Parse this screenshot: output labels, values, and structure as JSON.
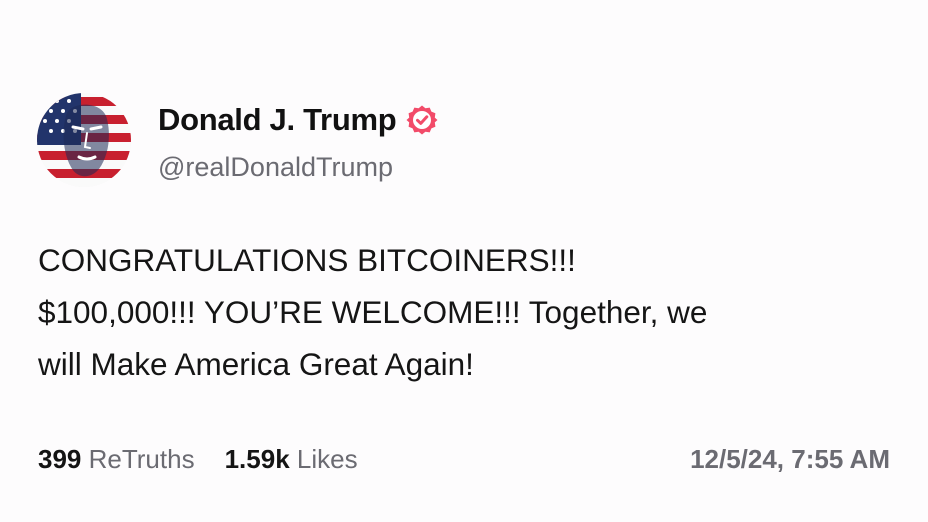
{
  "author": {
    "display_name": "Donald J. Trump",
    "handle": "@realDonaldTrump",
    "verified_icon": "verified-badge-icon",
    "avatar": "flag-portrait-avatar"
  },
  "post": {
    "lines": [
      "CONGRATULATIONS BITCOINERS!!!",
      "$100,000!!! YOU’RE WELCOME!!! Together, we",
      "will Make America Great Again!"
    ]
  },
  "stats": {
    "retruths_count": "399",
    "retruths_label": "ReTruths",
    "likes_count": "1.59k",
    "likes_label": "Likes"
  },
  "timestamp": "12/5/24, 7:55 AM",
  "colors": {
    "verified_badge": "#f24b69",
    "muted_text": "#6b6b72",
    "flag_red": "#c8202f",
    "flag_blue": "#22346b"
  }
}
